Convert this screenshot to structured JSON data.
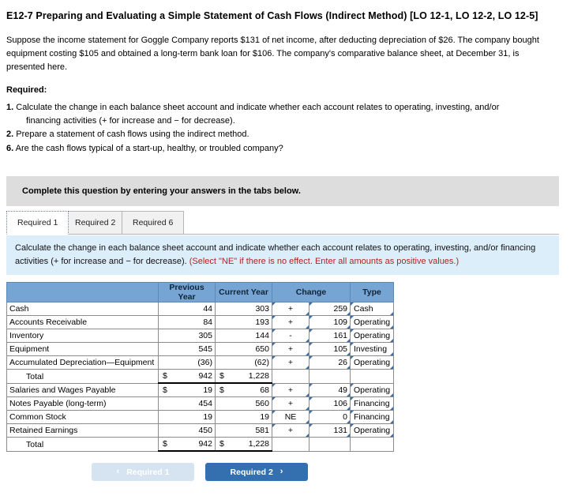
{
  "exercise": {
    "title": "E12-7 Preparing and Evaluating a Simple Statement of Cash Flows (Indirect Method) [LO 12-1, LO 12-2, LO 12-5]",
    "intro": "Suppose the income statement for Goggle Company reports $131 of net income, after deducting depreciation of $26. The company bought equipment costing $105 and obtained a long-term bank loan for $106. The company's comparative balance sheet, at December 31, is presented here.",
    "required_heading": "Required:",
    "required_items": [
      {
        "num": "1.",
        "text": "Calculate the change in each balance sheet account and indicate whether each account relates to operating, investing, and/or",
        "cont": "financing activities (+ for increase and − for decrease)."
      },
      {
        "num": "2.",
        "text": "Prepare a statement of cash flows using the indirect method.",
        "cont": ""
      },
      {
        "num": "6.",
        "text": "Are the cash flows typical of a start-up, healthy, or troubled company?",
        "cont": ""
      }
    ]
  },
  "banner": {
    "text": "Complete this question by entering your answers in the tabs below."
  },
  "tabs": [
    {
      "label": "Required 1",
      "active": true
    },
    {
      "label": "Required 2",
      "active": false
    },
    {
      "label": "Required 6",
      "active": false
    }
  ],
  "info_panel": {
    "text": "Calculate the change in each balance sheet account and indicate whether each account relates to operating, investing, and/or financing activities (+ for increase and − for decrease). ",
    "hint": "(Select \"NE\" if there is no effect. Enter all amounts as positive values.)"
  },
  "table": {
    "headers": [
      "",
      "Previous Year",
      "Current Year",
      "Change",
      "Type"
    ],
    "rows": [
      {
        "label": "Cash",
        "indent": false,
        "prev_sym": "",
        "prev": "44",
        "curr_sym": "",
        "curr": "303",
        "sign": "+",
        "amount": "259",
        "type": "Cash",
        "is_total": false,
        "has_inputs": true
      },
      {
        "label": "Accounts Receivable",
        "indent": false,
        "prev_sym": "",
        "prev": "84",
        "curr_sym": "",
        "curr": "193",
        "sign": "+",
        "amount": "109",
        "type": "Operating",
        "is_total": false,
        "has_inputs": true
      },
      {
        "label": "Inventory",
        "indent": false,
        "prev_sym": "",
        "prev": "305",
        "curr_sym": "",
        "curr": "144",
        "sign": "-",
        "amount": "161",
        "type": "Operating",
        "is_total": false,
        "has_inputs": true
      },
      {
        "label": "Equipment",
        "indent": false,
        "prev_sym": "",
        "prev": "545",
        "curr_sym": "",
        "curr": "650",
        "sign": "+",
        "amount": "105",
        "type": "Investing",
        "is_total": false,
        "has_inputs": true
      },
      {
        "label": "Accumulated Depreciation—Equipment",
        "indent": false,
        "prev_sym": "",
        "prev": "(36)",
        "curr_sym": "",
        "curr": "(62)",
        "sign": "+",
        "amount": "26",
        "type": "Operating",
        "is_total": false,
        "has_inputs": true
      },
      {
        "label": "Total",
        "indent": true,
        "prev_sym": "$",
        "prev": "942",
        "curr_sym": "$",
        "curr": "1,228",
        "sign": "",
        "amount": "",
        "type": "",
        "is_total": true,
        "has_inputs": false
      },
      {
        "label": "Salaries and Wages Payable",
        "indent": false,
        "prev_sym": "$",
        "prev": "19",
        "curr_sym": "$",
        "curr": "68",
        "sign": "+",
        "amount": "49",
        "type": "Operating",
        "is_total": false,
        "has_inputs": true
      },
      {
        "label": "Notes Payable (long-term)",
        "indent": false,
        "prev_sym": "",
        "prev": "454",
        "curr_sym": "",
        "curr": "560",
        "sign": "+",
        "amount": "106",
        "type": "Financing",
        "is_total": false,
        "has_inputs": true
      },
      {
        "label": "Common Stock",
        "indent": false,
        "prev_sym": "",
        "prev": "19",
        "curr_sym": "",
        "curr": "19",
        "sign": "NE",
        "amount": "0",
        "type": "Financing",
        "is_total": false,
        "has_inputs": true
      },
      {
        "label": "Retained Earnings",
        "indent": false,
        "prev_sym": "",
        "prev": "450",
        "curr_sym": "",
        "curr": "581",
        "sign": "+",
        "amount": "131",
        "type": "Operating",
        "is_total": false,
        "has_inputs": true
      },
      {
        "label": "Total",
        "indent": true,
        "prev_sym": "$",
        "prev": "942",
        "curr_sym": "$",
        "curr": "1,228",
        "sign": "",
        "amount": "",
        "type": "",
        "is_total": true,
        "has_inputs": false
      }
    ]
  },
  "nav": {
    "prev_label": "Required 1",
    "next_label": "Required 2",
    "prev_chevron": "‹",
    "next_chevron": "›"
  },
  "colors": {
    "header_blue": "#76a5d4",
    "panel_blue": "#ddeefb",
    "banner_gray": "#dddddd",
    "accent_blue": "#3470b0",
    "hint_red": "#b22222"
  }
}
